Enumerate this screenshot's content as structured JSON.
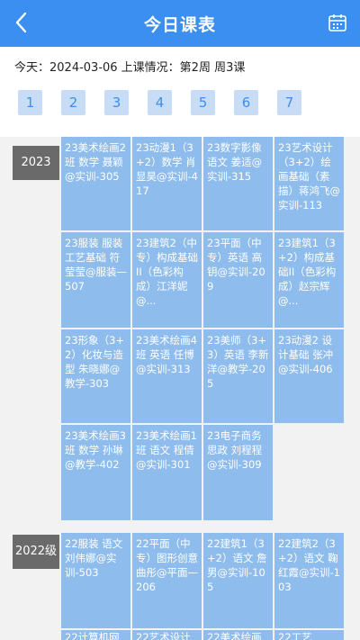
{
  "header": {
    "title": "今日课表"
  },
  "info": {
    "today": "今天：2024-03-06 上课情况：第2周 周3课"
  },
  "days": [
    "1",
    "2",
    "3",
    "4",
    "5",
    "6",
    "7"
  ],
  "sections": [
    {
      "grade": "2023",
      "cells": [
        "23美术绘画2班 数学 聂颖@实训-305",
        "23动漫1（3+2）数学 肖显昊@实训-417",
        "23数字影像 语文 姜适@实训-315",
        "23艺术设计（3+2）绘画基础（素描）蒋鸿飞@实训-113",
        "23服装 服装工艺基础 符莹莹@服装—507",
        "23建筑2（中专）构成基础II（色彩构成）江洋妮@...",
        "23平面（中专）英语 高钥@实训-209",
        "23建筑1（3+2）构成基础II（色彩构成）赵宗辉@...",
        "23形象（3+2）化妆与造型 朱晓娜@教学-303",
        "23美术绘画4班 英语 任博@实训-313",
        "23美师（3+3）英语 李新洋@教学-205",
        "23动漫2 设计基础 张冲@实训-406",
        "23美术绘画3班 数学 孙琳@教学-402",
        "23美术绘画1班 语文 程倩@实训-301",
        "23电子商务 思政 刘程程@实训-309"
      ]
    },
    {
      "grade": "2022级",
      "cells": [
        "22服装 语文 刘伟娜@实训-503",
        "22平面（中专）图形创意 曲彤@平面—206",
        "22建筑1（3+2）语文 詹男@实训-105",
        "22建筑2（3+2）语文 鞠红霞@实训-103",
        "22计算机网",
        "22艺术设计",
        "22美术绘画",
        "22工艺"
      ]
    }
  ]
}
